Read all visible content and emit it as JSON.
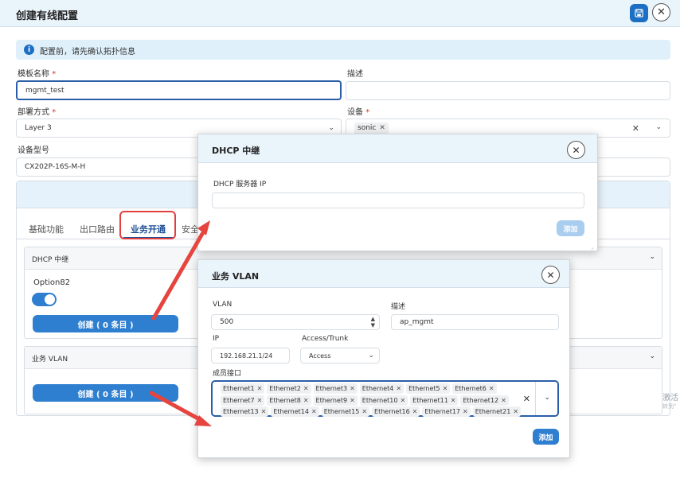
{
  "header": {
    "title": "创建有线配置"
  },
  "info": {
    "text": "配置前，请先确认拓扑信息"
  },
  "form": {
    "template_name_label": "模板名称",
    "template_name_value": "mgmt_test",
    "desc_label": "描述",
    "desc_value": "",
    "deploy_label": "部署方式",
    "deploy_value": "Layer 3",
    "device_label": "设备",
    "device_chip": "sonic",
    "model_label": "设备型号",
    "model_value": "CX202P-16S-M-H"
  },
  "tabs": [
    "基础功能",
    "出口路由",
    "业务开通",
    "安全"
  ],
  "sections": {
    "dhcp": {
      "title": "DHCP 中继",
      "option_label": "Option82",
      "create_label": "创建 ( 0 条目 )"
    },
    "vlan": {
      "title": "业务 VLAN",
      "create_label": "创建 ( 0 条目 )"
    }
  },
  "dhcp_modal": {
    "title": "DHCP 中继",
    "server_ip_label": "DHCP 服务器 IP",
    "server_ip_value": "",
    "add_label": "添加"
  },
  "vlan_modal": {
    "title": "业务 VLAN",
    "vlan_label": "VLAN",
    "vlan_value": "500",
    "desc_label": "描述",
    "desc_value": "ap_mgmt",
    "ip_label": "IP",
    "ip_value": "192.168.21.1/24",
    "mode_label": "Access/Trunk",
    "mode_value": "Access",
    "members_label": "成员接口",
    "members": [
      [
        "Ethernet1",
        "Ethernet2",
        "Ethernet3",
        "Ethernet4",
        "Ethernet5",
        "Ethernet6"
      ],
      [
        "Ethernet7",
        "Ethernet8",
        "Ethernet9",
        "Ethernet10",
        "Ethernet11",
        "Ethernet12"
      ],
      [
        "Ethernet13",
        "Ethernet14",
        "Ethernet15",
        "Ethernet16",
        "Ethernet17",
        "Ethernet21"
      ]
    ],
    "add_label": "添加"
  },
  "watermark": {
    "line1": "激活",
    "line2": "转到\""
  },
  "colors": {
    "primary": "#2f7fd1",
    "accent_dark": "#1d6fc4",
    "highlight": "#e33f3f",
    "disabled": "#a9cdee"
  }
}
